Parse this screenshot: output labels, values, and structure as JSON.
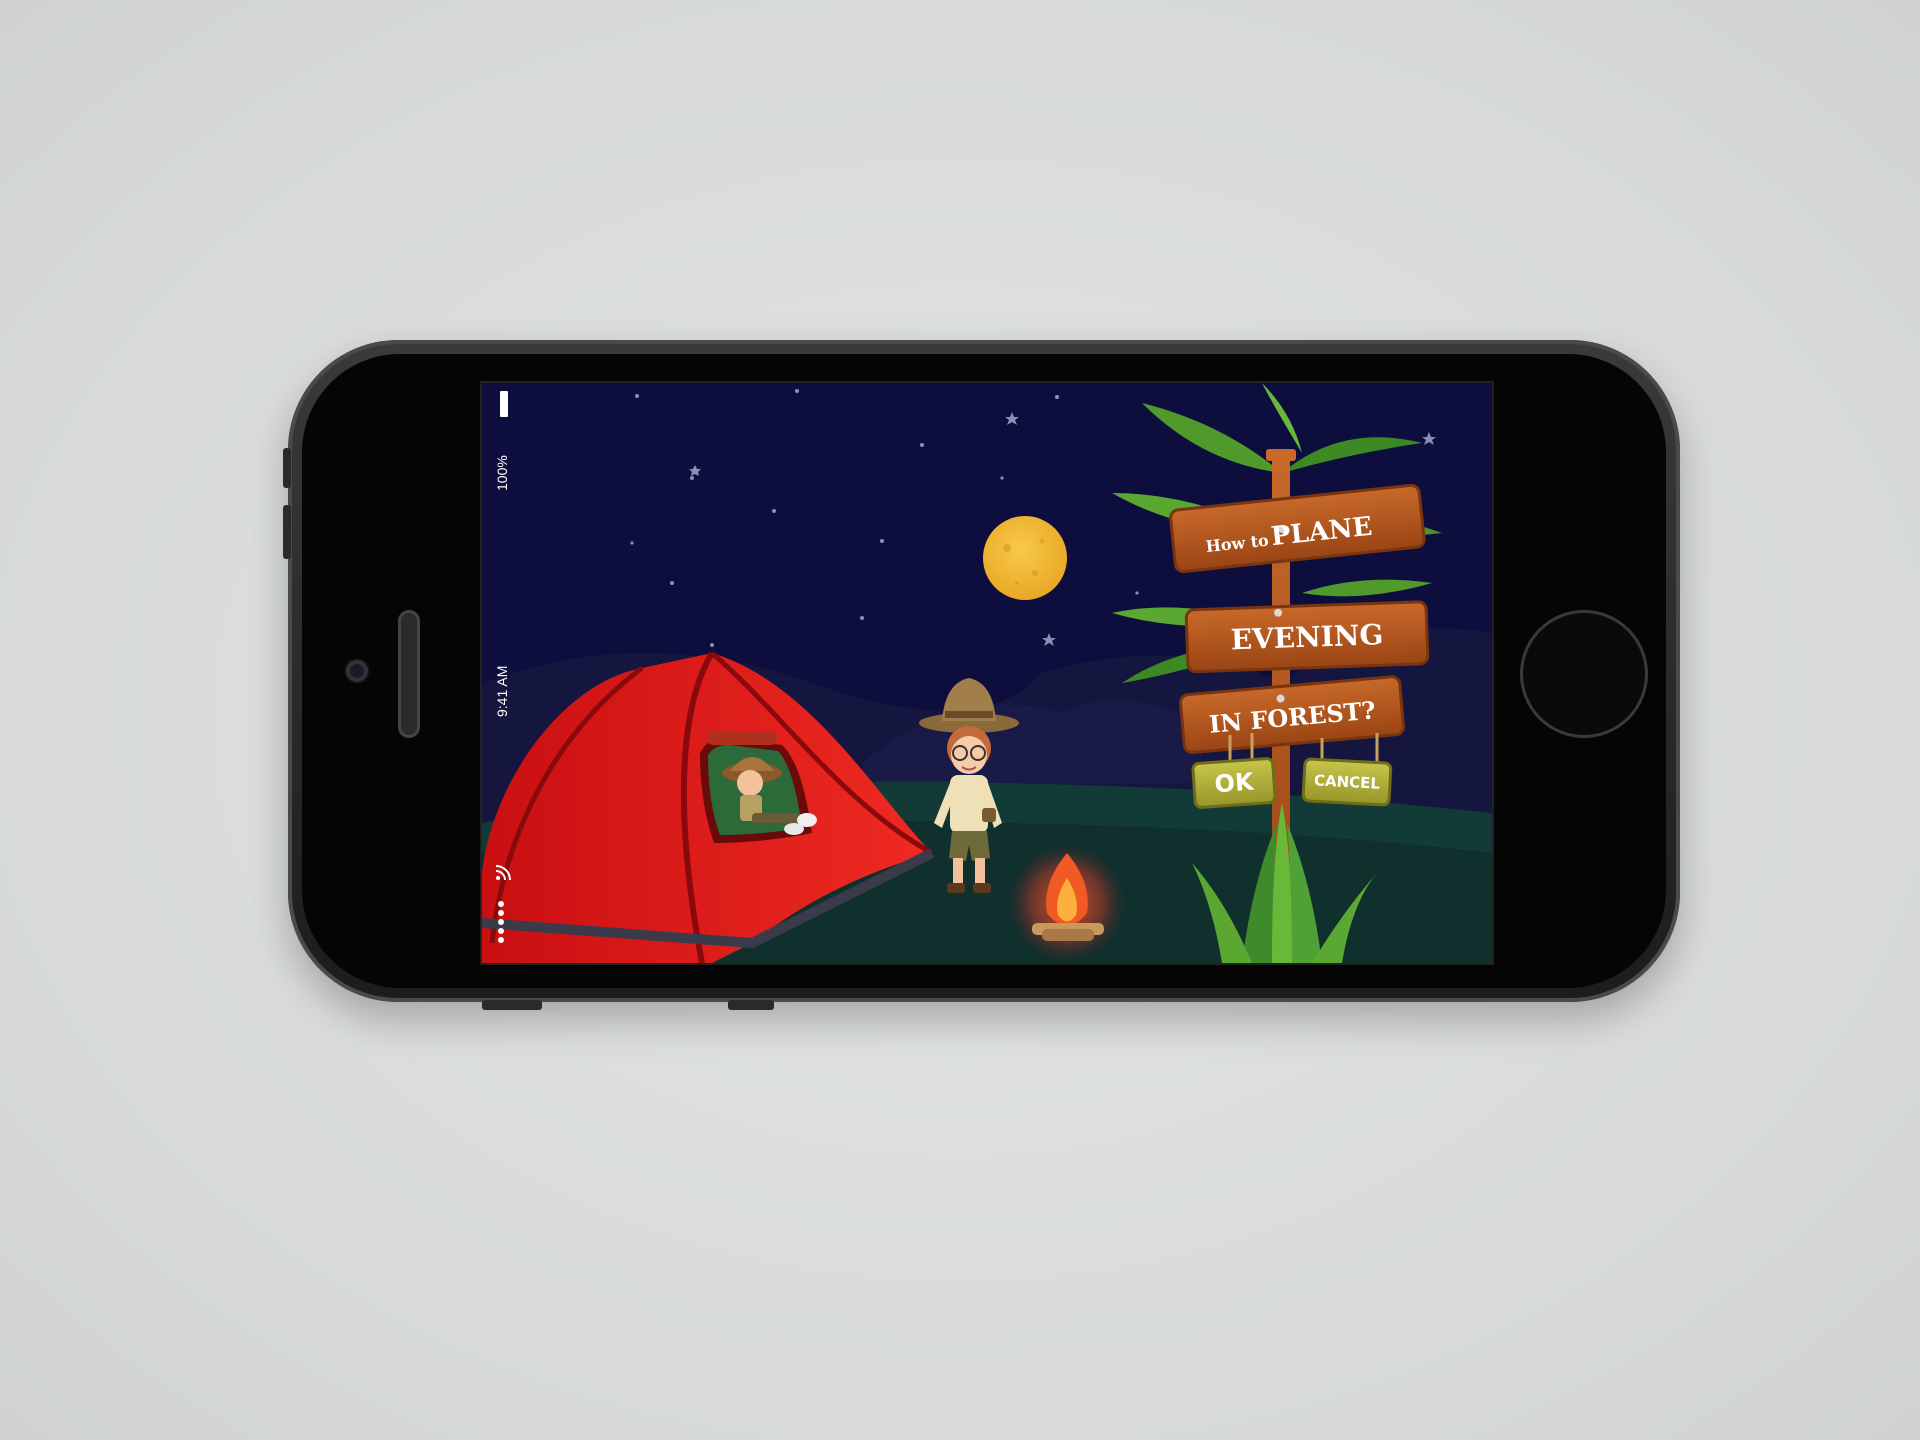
{
  "status_bar": {
    "battery_pct": "100%",
    "time": "9:41 AM"
  },
  "sign": {
    "line1_small": "How to",
    "line1_big": "PLANE",
    "line2": "EVENING",
    "line3": "IN FOREST?"
  },
  "buttons": {
    "ok": "OK",
    "cancel": "CANCEL"
  },
  "colors": {
    "sky": "#0d0e3e",
    "tent": "#e3161b",
    "moon": "#f1b730",
    "wood": "#b45a1e",
    "button_wood": "#b7b63c"
  }
}
